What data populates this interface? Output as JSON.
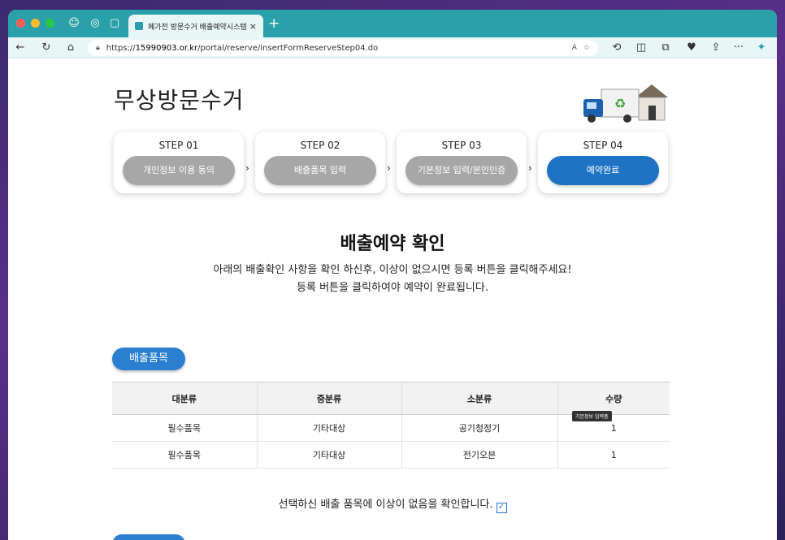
{
  "browser": {
    "tab_title": "폐가전 방문수거 배출예약시스템",
    "tab_close": "×",
    "new_tab": "+",
    "url_prefix": "https://",
    "url_host": "15990903.or.kr",
    "url_path": "/portal/reserve/insertFormReserveStep04.do",
    "read_aloud": "A",
    "more": "···"
  },
  "page": {
    "site_title": "무상방문수거",
    "steps": [
      {
        "label": "STEP 01",
        "name": "개인정보 이용 동의",
        "active": false
      },
      {
        "label": "STEP 02",
        "name": "배출품목 입력",
        "active": false
      },
      {
        "label": "STEP 03",
        "name": "기본정보 입력/본인인증",
        "active": false
      },
      {
        "label": "STEP 04",
        "name": "예약완료",
        "active": true
      }
    ],
    "heading": "배출예약 확인",
    "desc_line1": "아래의 배출확인 사항을 확인 하신후, 이상이 없으시면 등록 버튼을 클릭해주세요!",
    "desc_line2": "등록 버튼을 클릭하여야 예약이 완료됩니다.",
    "section_label": "배출품목",
    "table": {
      "headers": [
        "대분류",
        "중분류",
        "소분류",
        "수량"
      ],
      "rows": [
        [
          "필수품목",
          "기타대상",
          "공기청정기",
          "1"
        ],
        [
          "필수품목",
          "기타대상",
          "전기오븐",
          "1"
        ]
      ]
    },
    "tooltip": "기본정보 입력폼",
    "confirm_text": "선택하신 배출 품목에 이상이 없음을 확인합니다.",
    "step_arrow": "›"
  },
  "colors": {
    "accent": "#1f73c4",
    "inactive_step": "#a7a7a7",
    "browser_chrome": "#2aa0a8"
  }
}
